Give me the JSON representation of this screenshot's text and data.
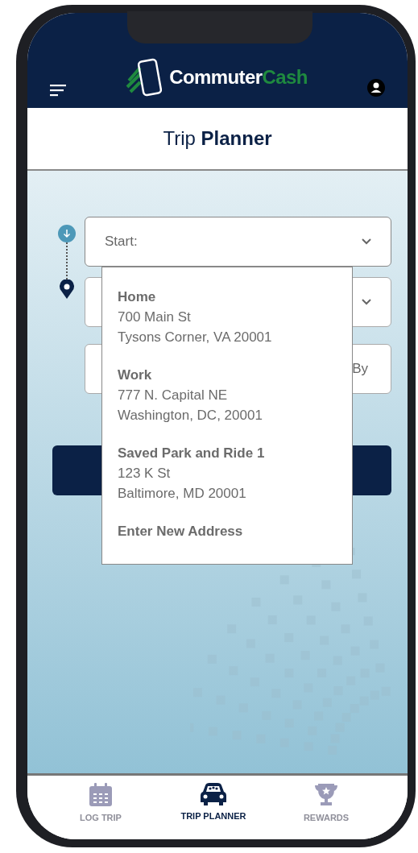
{
  "header": {
    "logo": {
      "text": "Commuter",
      "accent": "Cash"
    }
  },
  "title": "Trip **Planner**",
  "fields": [
    {
      "kind": "select",
      "placeholder": "Start:",
      "expanded": true
    },
    {
      "kind": "select",
      "expanded": false
    },
    {
      "kind": "text",
      "value": "By"
    }
  ],
  "dropdown": [
    {
      "kind": "address",
      "title": "Home",
      "lines": [
        "700 Main St",
        "Tysons Corner, VA 20001"
      ]
    },
    {
      "kind": "address",
      "title": "Work",
      "lines": [
        "777 N. Capital NE",
        "Washington, DC, 20001"
      ]
    },
    {
      "kind": "address",
      "title": "Saved Park and Ride 1",
      "lines": [
        "123 K St",
        "Baltimore, MD 20001"
      ]
    },
    {
      "kind": "action",
      "title": "Enter New Address"
    }
  ],
  "nav": [
    {
      "kind": "calendar",
      "label": "LOG TRIP",
      "selected": false
    },
    {
      "kind": "car",
      "label": "TRIP PLANNER",
      "selected": true
    },
    {
      "kind": "trophy",
      "label": "REWARDS",
      "selected": false
    }
  ]
}
